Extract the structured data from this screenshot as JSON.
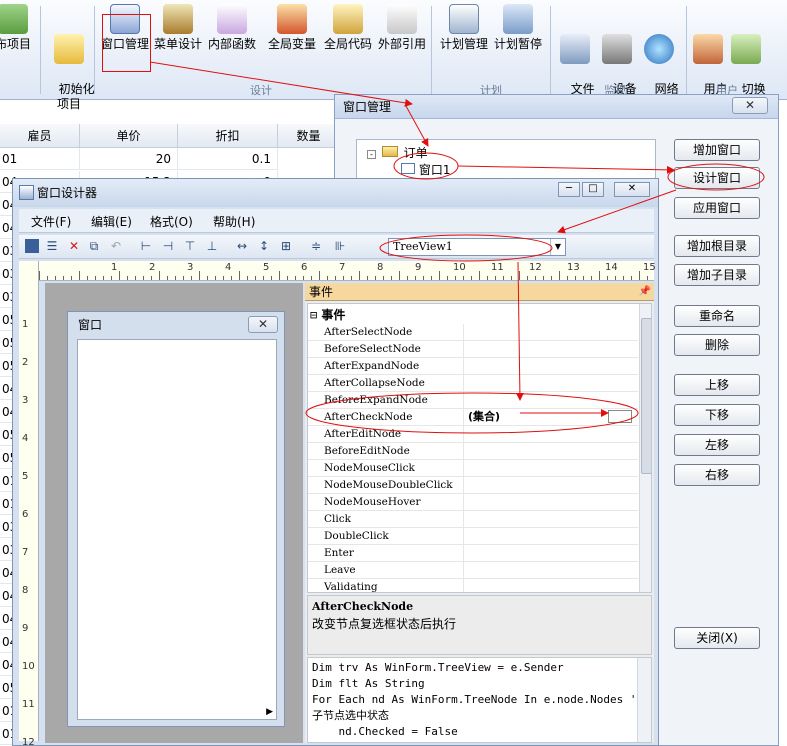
{
  "ribbon": {
    "buttons": [
      {
        "label": "布项目"
      },
      {
        "label": "初始化\n项目"
      },
      {
        "label": "窗口管理"
      },
      {
        "label": "菜单设计"
      },
      {
        "label": "内部函数"
      },
      {
        "label": "全局变量"
      },
      {
        "label": "全局代码"
      },
      {
        "label": "外部引用"
      },
      {
        "label": "计划管理"
      },
      {
        "label": "计划暂停"
      },
      {
        "label": "文件\n监视器"
      },
      {
        "label": "设备\n监视器"
      },
      {
        "label": "网络\n监视器"
      },
      {
        "label": "用户\n管理"
      },
      {
        "label": "切换\n用户"
      }
    ],
    "groups": {
      "design": "设计",
      "plan": "计划",
      "monitor": "监视",
      "user": "用户"
    }
  },
  "grid": {
    "headers": [
      "雇员",
      "单价",
      "折扣",
      "数量"
    ],
    "rows": [
      {
        "id": "01",
        "price": "20",
        "discount": "0.1"
      },
      {
        "id": "04",
        "price": "15.2",
        "discount": "0"
      },
      {
        "id": "04",
        "price": "39.2",
        "discount": "0"
      },
      {
        "id": "04",
        "price": "",
        "discount": ""
      },
      {
        "id": "03",
        "price": "",
        "discount": ""
      },
      {
        "id": "03",
        "price": "",
        "discount": ""
      },
      {
        "id": "03",
        "price": "",
        "discount": ""
      },
      {
        "id": "05",
        "price": "",
        "discount": ""
      },
      {
        "id": "05",
        "price": "",
        "discount": ""
      },
      {
        "id": "05",
        "price": "",
        "discount": ""
      },
      {
        "id": "04",
        "price": "",
        "discount": ""
      },
      {
        "id": "04",
        "price": "",
        "discount": ""
      },
      {
        "id": "05",
        "price": "",
        "discount": ""
      },
      {
        "id": "05",
        "price": "",
        "discount": ""
      },
      {
        "id": "01",
        "price": "",
        "discount": ""
      },
      {
        "id": "01",
        "price": "",
        "discount": ""
      },
      {
        "id": "03",
        "price": "",
        "discount": ""
      },
      {
        "id": "03",
        "price": "",
        "discount": ""
      },
      {
        "id": "04",
        "price": "",
        "discount": ""
      },
      {
        "id": "04",
        "price": "",
        "discount": ""
      },
      {
        "id": "04",
        "price": "",
        "discount": ""
      },
      {
        "id": "04",
        "price": "",
        "discount": ""
      },
      {
        "id": "04",
        "price": "",
        "discount": ""
      },
      {
        "id": "05",
        "price": "",
        "discount": ""
      },
      {
        "id": "01",
        "price": "",
        "discount": ""
      },
      {
        "id": "01",
        "price": "",
        "discount": ""
      }
    ]
  },
  "window_manager": {
    "title": "窗口管理",
    "close": "✕",
    "tree": {
      "root": "订单",
      "child": "窗口1"
    },
    "buttons": [
      "增加窗口",
      "设计窗口",
      "应用窗口",
      "增加根目录",
      "增加子目录",
      "重命名",
      "删除",
      "上移",
      "下移",
      "左移",
      "右移",
      "关闭(X)"
    ]
  },
  "designer": {
    "title": "窗口设计器",
    "menus": [
      "文件(F)",
      "编辑(E)",
      "格式(O)",
      "帮助(H)"
    ],
    "combo": "TreeView1",
    "form_title": "窗口",
    "ruler_h": [
      "1",
      "2",
      "3",
      "4",
      "5",
      "6",
      "7",
      "8",
      "9",
      "10",
      "11",
      "12",
      "13",
      "14",
      "15"
    ],
    "ruler_v": [
      "1",
      "2",
      "3",
      "4",
      "5",
      "6",
      "7",
      "8",
      "9",
      "10",
      "11",
      "12"
    ],
    "events_header": "事件",
    "events_category": "事件",
    "events": [
      "AfterSelectNode",
      "BeforeSelectNode",
      "AfterExpandNode",
      "AfterCollapseNode",
      "BeforeExpandNode",
      "AfterCheckNode",
      "AfterEditNode",
      "BeforeEditNode",
      "NodeMouseClick",
      "NodeMouseDoubleClick",
      "NodeMouseHover",
      "Click",
      "DoubleClick",
      "Enter",
      "Leave",
      "Validating"
    ],
    "selected_value": "(集合)",
    "desc_title": "AfterCheckNode",
    "desc_text": "改变节点复选框状态后执行",
    "code_lines": [
      "Dim trv As WinForm.TreeView = e.Sender",
      "Dim flt As String",
      "For Each nd As WinForm.TreeNode In e.node.Nodes '清除",
      "子节点选中状态",
      "    nd.Checked = False"
    ]
  }
}
